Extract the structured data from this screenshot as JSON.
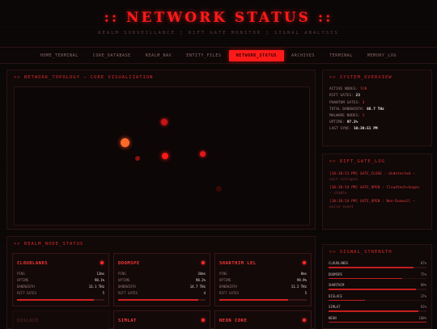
{
  "header": {
    "title": ":: NETWORK STATUS ::",
    "subtitle": "REALM SURVEILLANCE  |  RIFT GATE MONITOR  |  SIGNAL ANALYSIS"
  },
  "nav": {
    "tabs": [
      "HOME_TERMINAL",
      "CORE_DATABASE",
      "REALM_NAV",
      "ENTITY_FILES",
      "NETWORK_STATUS",
      "ARCHIVES",
      "TERMINAL",
      "MEMORY_LOG"
    ],
    "active_tab": "NETWORK_STATUS"
  },
  "topology": {
    "header": ">> NETWORK_TOPOLOGY — CORE VISUALIZATION",
    "node_color": "#ff1a1a",
    "hub_color": "#ff6a2a"
  },
  "system": {
    "header": ">> SYSTEM_OVERVIEW",
    "items": [
      {
        "label": "ACTIVE NODES:",
        "value": "7/8",
        "color": "red"
      },
      {
        "label": "RIFT GATES:",
        "value": "23",
        "color": "white"
      },
      {
        "label": "PHANTOM GATES:",
        "value": "3",
        "color": "red"
      },
      {
        "label": "TOTAL BANDWIDTH:",
        "value": "88.7 THz",
        "color": "white"
      },
      {
        "label": "MALWARE NODES:",
        "value": "1",
        "color": "red"
      },
      {
        "label": "UPTIME:",
        "value": "97.2%",
        "color": "white"
      },
      {
        "label": "LAST SYNC:",
        "value": "10:39:51 PM",
        "color": "white"
      }
    ]
  },
  "rift": {
    "header": ">> RIFT_GATE_LOG",
    "entries": [
      {
        "line": "[10:38:51 PM] GATE_CLOSE : Undetected —",
        "sub": "exit collapse"
      },
      {
        "line": "[10:38:54 PM] GATE_OPEN : Cloudtech→Sogon",
        "sub": "— stable"
      },
      {
        "line": "[10:38:54 PM] GATE_OPEN : Neo-Dunwall —",
        "sub": "pulse event"
      }
    ]
  },
  "realm": {
    "header": ">> REALM_NODE_STATUS",
    "cards": [
      {
        "name": "CLOUDLANDS",
        "ping_label": "PING",
        "ping": "13ms",
        "uptime_label": "UPTIME",
        "uptime": "98.1%",
        "bw_label": "BANDWIDTH",
        "bw": "13.1 THz",
        "gates_label": "RIFT GATES",
        "gates": "5",
        "load": 0.88
      },
      {
        "name": "DOOMSPE",
        "ping_label": "PING",
        "ping": "34ms",
        "uptime_label": "UPTIME",
        "uptime": "98.2%",
        "bw_label": "BANDWIDTH",
        "bw": "14.7 THz",
        "gates_label": "RIFT GATES",
        "gates": "4",
        "load": 0.92
      },
      {
        "name": "SHARTHIM LEL",
        "ping_label": "PING",
        "ping": "8ms",
        "uptime_label": "UPTIME",
        "uptime": "99.9%",
        "bw_label": "BANDWIDTH",
        "bw": "11.2 THz",
        "gates_label": "RIFT GATES",
        "gates": "5",
        "load": 0.79
      },
      {
        "name": "DISLACE",
        "name_dim": true
      },
      {
        "name": "SIMLAT"
      },
      {
        "name": "NEON CORE"
      }
    ]
  },
  "signal": {
    "header": ">> SIGNAL_STRENGTH",
    "items": [
      {
        "label": "CLOUDLANDS",
        "value": 87,
        "text": "87%"
      },
      {
        "label": "DOOMSPE",
        "value": 75,
        "text": "75%"
      },
      {
        "label": "SHARTHIM",
        "value": 89,
        "text": "89%"
      },
      {
        "label": "DISLACE",
        "value": 37,
        "text": "37%"
      },
      {
        "label": "SIMLAT",
        "value": 92,
        "text": "92%"
      },
      {
        "label": "NEON",
        "value": 100,
        "text": "100%"
      }
    ]
  }
}
